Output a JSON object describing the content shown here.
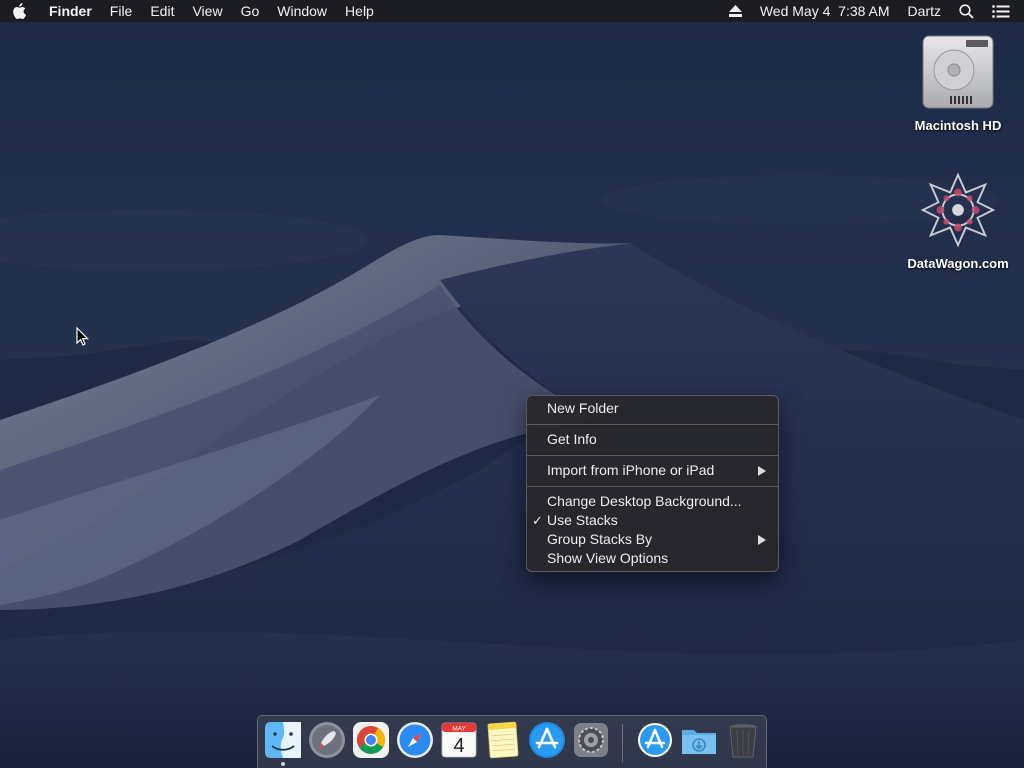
{
  "menubar": {
    "apple_icon": "apple-icon",
    "app_name": "Finder",
    "menus": [
      "File",
      "Edit",
      "View",
      "Go",
      "Window",
      "Help"
    ],
    "eject_icon": "eject-icon",
    "datetime": "Wed May 4  7:38 AM",
    "user": "Dartz",
    "search_icon": "spotlight-search-icon",
    "notifications_icon": "notification-center-icon"
  },
  "desktop": {
    "icons": [
      {
        "label": "Macintosh HD",
        "icon": "hard-drive-icon"
      },
      {
        "label": "DataWagon.com",
        "icon": "network-volume-icon"
      }
    ]
  },
  "context_menu": {
    "items": [
      {
        "label": "New Folder"
      },
      {
        "label": "Get Info"
      },
      {
        "label": "Import from iPhone or iPad",
        "submenu": true
      },
      {
        "label": "Change Desktop Background..."
      },
      {
        "label": "Use Stacks",
        "checked": true
      },
      {
        "label": "Group Stacks By",
        "submenu": true
      },
      {
        "label": "Show View Options"
      }
    ]
  },
  "dock": {
    "apps": [
      "finder-icon",
      "launchpad-icon",
      "chrome-icon",
      "safari-icon",
      "calendar-icon",
      "notes-icon",
      "app-store-icon",
      "system-preferences-icon"
    ],
    "calendar": {
      "month": "MAY",
      "day": "4"
    },
    "others": [
      "app-store-download-icon",
      "downloads-folder-icon",
      "trash-icon"
    ]
  },
  "colors": {
    "menubar_bg": "#1c1c20",
    "menu_bg": "#28282c",
    "desktop_sky": "#1e2a44"
  }
}
